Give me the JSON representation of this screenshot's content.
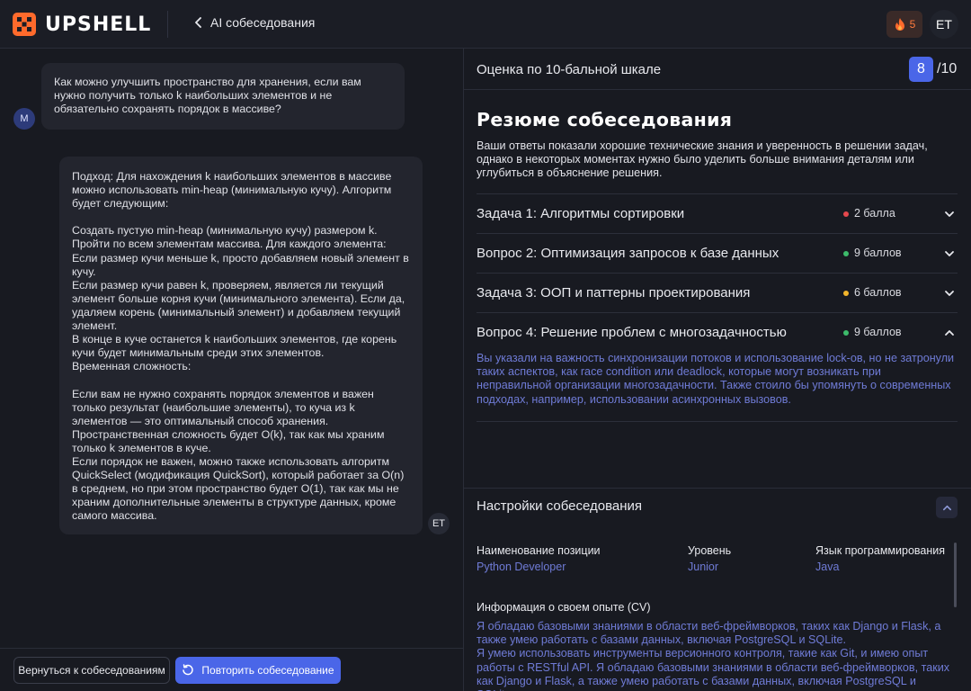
{
  "header": {
    "brand": "UPSHELL",
    "back_label": "AI собеседования",
    "streak_count": "5",
    "user_initials": "ET"
  },
  "chat": {
    "question": {
      "avatar": "M",
      "text": "Как можно улучшить пространство для хранения, если вам нужно получить только k наибольших элементов и не обязательно сохранять порядок в массиве?"
    },
    "answer": {
      "avatar": "ET",
      "text": "Подход: Для нахождения k наибольших элементов в массиве можно использовать min-heap (минимальную кучу). Алгоритм будет следующим:\n\nСоздать пустую min-heap (минимальную кучу) размером k.\nПройти по всем элементам массива. Для каждого элемента:\nЕсли размер кучи меньше k, просто добавляем новый элемент в кучу.\nЕсли размер кучи равен k, проверяем, является ли текущий элемент больше корня кучи (минимального элемента). Если да, удаляем корень (минимальный элемент) и добавляем текущий элемент.\nВ конце в куче останется k наибольших элементов, где корень кучи будет минимальным среди этих элементов.\nВременная сложность:\n\nЕсли вам не нужно сохранять порядок элементов и важен только результат (наибольшие элементы), то куча из k элементов — это оптимальный способ хранения.\nПространственная сложность будет O(k), так как мы храним только k элементов в куче.\nЕсли порядок не важен, можно также использовать алгоритм QuickSelect (модификация QuickSort), который работает за O(n) в среднем, но при этом пространство будет O(1), так как мы не храним дополнительные элементы в структуре данных, кроме самого массива."
    },
    "footer": {
      "back_button": "Вернуться к собеседованиям",
      "retry_button": "Повторить собеседование"
    }
  },
  "score": {
    "label": "Оценка по 10-бальной шкале",
    "value": "8",
    "max": "/10"
  },
  "summary": {
    "title": "Резюме собеседования",
    "text": "Ваши ответы показали хорошие технические знания и уверенность в решении задач, однако в некоторых моментах нужно было уделить больше внимания деталям или углубиться в объяснение решения."
  },
  "tasks": [
    {
      "name": "Задача 1: Алгоритмы сортировки",
      "score": "2 балла",
      "dot_color": "#e5484d",
      "expanded": false
    },
    {
      "name": "Вопрос 2: Оптимизация запросов к базе данных",
      "score": "9 баллов",
      "dot_color": "#3dbb6b",
      "expanded": false
    },
    {
      "name": "Задача 3: ООП и паттерны проектирования",
      "score": "6 баллов",
      "dot_color": "#f2b52c",
      "expanded": false
    },
    {
      "name": "Вопрос 4: Решение проблем с многозадачностью",
      "score": "9 баллов",
      "dot_color": "#3dbb6b",
      "expanded": true,
      "detail": "Вы указали на важность синхронизации потоков и использование lock-ов, но не затронули таких аспектов, как race condition или deadlock, которые могут возникать при неправильной организации многозадачности. Также стоило бы упомянуть о современных подходах, например, использовании асинхронных вызовов."
    }
  ],
  "settings": {
    "title": "Настройки собеседования",
    "position_label": "Наименование позиции",
    "position_value": "Python Developer",
    "level_label": "Уровень",
    "level_value": "Junior",
    "language_label": "Язык программирования",
    "language_value": "Java",
    "cv_label": "Информация о своем опыте (CV)",
    "cv_text": "Я обладаю базовыми знаниями в области веб-фреймворков, таких как Django и Flask, а также умею работать с базами данных, включая PostgreSQL и SQLite.\nЯ умею использовать инструменты версионного контроля, такие как Git, и имею опыт работы с RESTful API. Я обладаю базовыми знаниями в области веб-фреймворков, таких как Django и Flask, а также умею работать с базами данных, включая PostgreSQL и SQLite."
  },
  "colors": {
    "accent": "#4a66e8",
    "link": "#6f7bd6",
    "background": "#181a21",
    "bubble": "#23252e",
    "streak": "#ff7a3d"
  },
  "icons": [
    "upshell-logo-icon",
    "chevron-left-icon",
    "fire-icon",
    "refresh-icon",
    "chevron-down-icon",
    "chevron-up-icon"
  ]
}
